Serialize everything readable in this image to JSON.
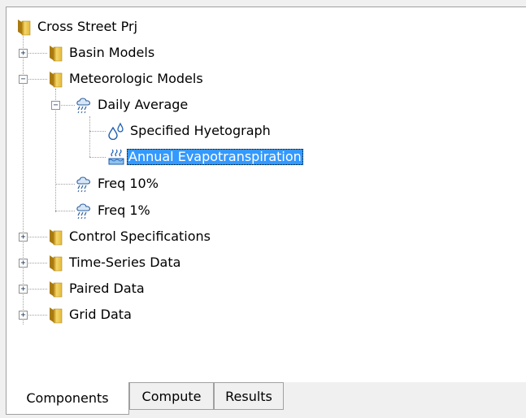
{
  "tree": {
    "root": "Cross Street Prj",
    "basin_models": "Basin Models",
    "meteorologic_models": "Meteorologic Models",
    "daily_average": "Daily Average",
    "specified_hyetograph": "Specified Hyetograph",
    "annual_evapotranspiration": "Annual Evapotranspiration",
    "freq_10": "Freq 10%",
    "freq_1": "Freq 1%",
    "control_specifications": "Control Specifications",
    "time_series_data": "Time-Series Data",
    "paired_data": "Paired Data",
    "grid_data": "Grid Data",
    "selected": "Annual Evapotranspiration"
  },
  "tabs": {
    "components": "Components",
    "compute": "Compute",
    "results": "Results",
    "active": "Components"
  },
  "icons": {
    "folder": "folder-icon",
    "meteorologic": "rain-cloud-icon",
    "precipitation": "water-drops-icon",
    "evapotranspiration": "evapotranspiration-icon"
  },
  "colors": {
    "selection": "#3399ff",
    "folder": "#e8c24a"
  }
}
